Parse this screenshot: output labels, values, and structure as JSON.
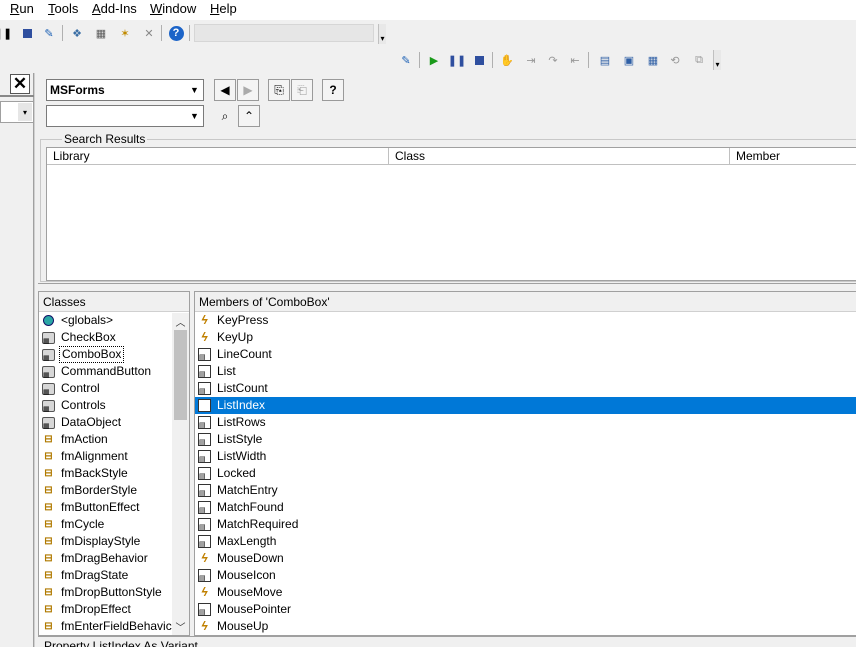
{
  "menu": {
    "items": [
      {
        "label": "Run",
        "accel": "R",
        "rest": "un"
      },
      {
        "label": "Tools",
        "accel": "T",
        "rest": "ools"
      },
      {
        "label": "Add-Ins",
        "accel": "A",
        "rest": "dd-Ins"
      },
      {
        "label": "Window",
        "accel": "W",
        "rest": "indow"
      },
      {
        "label": "Help",
        "accel": "H",
        "rest": "elp"
      }
    ]
  },
  "object_browser": {
    "library_combo": "MSForms",
    "search_combo": "",
    "search_results_label": "Search Results",
    "columns": [
      "Library",
      "Class",
      "Member"
    ],
    "classes_header": "Classes",
    "classes": [
      {
        "name": "<globals>",
        "icon": "globals-icon"
      },
      {
        "name": "CheckBox",
        "icon": "class-icon"
      },
      {
        "name": "ComboBox",
        "icon": "class-icon",
        "selected": true
      },
      {
        "name": "CommandButton",
        "icon": "class-icon"
      },
      {
        "name": "Control",
        "icon": "class-icon"
      },
      {
        "name": "Controls",
        "icon": "class-icon"
      },
      {
        "name": "DataObject",
        "icon": "class-icon"
      },
      {
        "name": "fmAction",
        "icon": "enum-icon"
      },
      {
        "name": "fmAlignment",
        "icon": "enum-icon"
      },
      {
        "name": "fmBackStyle",
        "icon": "enum-icon"
      },
      {
        "name": "fmBorderStyle",
        "icon": "enum-icon"
      },
      {
        "name": "fmButtonEffect",
        "icon": "enum-icon"
      },
      {
        "name": "fmCycle",
        "icon": "enum-icon"
      },
      {
        "name": "fmDisplayStyle",
        "icon": "enum-icon"
      },
      {
        "name": "fmDragBehavior",
        "icon": "enum-icon"
      },
      {
        "name": "fmDragState",
        "icon": "enum-icon"
      },
      {
        "name": "fmDropButtonStyle",
        "icon": "enum-icon"
      },
      {
        "name": "fmDropEffect",
        "icon": "enum-icon"
      },
      {
        "name": "fmEnterFieldBehavic",
        "icon": "enum-icon"
      }
    ],
    "members_header": "Members of 'ComboBox'",
    "members": [
      {
        "name": "KeyPress",
        "icon": "event-icon"
      },
      {
        "name": "KeyUp",
        "icon": "event-icon"
      },
      {
        "name": "LineCount",
        "icon": "property-icon"
      },
      {
        "name": "List",
        "icon": "property-icon"
      },
      {
        "name": "ListCount",
        "icon": "property-icon"
      },
      {
        "name": "ListIndex",
        "icon": "property-icon",
        "selected": true
      },
      {
        "name": "ListRows",
        "icon": "property-icon"
      },
      {
        "name": "ListStyle",
        "icon": "property-icon"
      },
      {
        "name": "ListWidth",
        "icon": "property-icon"
      },
      {
        "name": "Locked",
        "icon": "property-icon"
      },
      {
        "name": "MatchEntry",
        "icon": "property-icon"
      },
      {
        "name": "MatchFound",
        "icon": "property-icon"
      },
      {
        "name": "MatchRequired",
        "icon": "property-icon"
      },
      {
        "name": "MaxLength",
        "icon": "property-icon"
      },
      {
        "name": "MouseDown",
        "icon": "event-icon"
      },
      {
        "name": "MouseIcon",
        "icon": "property-icon"
      },
      {
        "name": "MouseMove",
        "icon": "event-icon"
      },
      {
        "name": "MousePointer",
        "icon": "property-icon"
      },
      {
        "name": "MouseUp",
        "icon": "event-icon"
      }
    ],
    "status_text": "Property ListIndex As Variant"
  }
}
